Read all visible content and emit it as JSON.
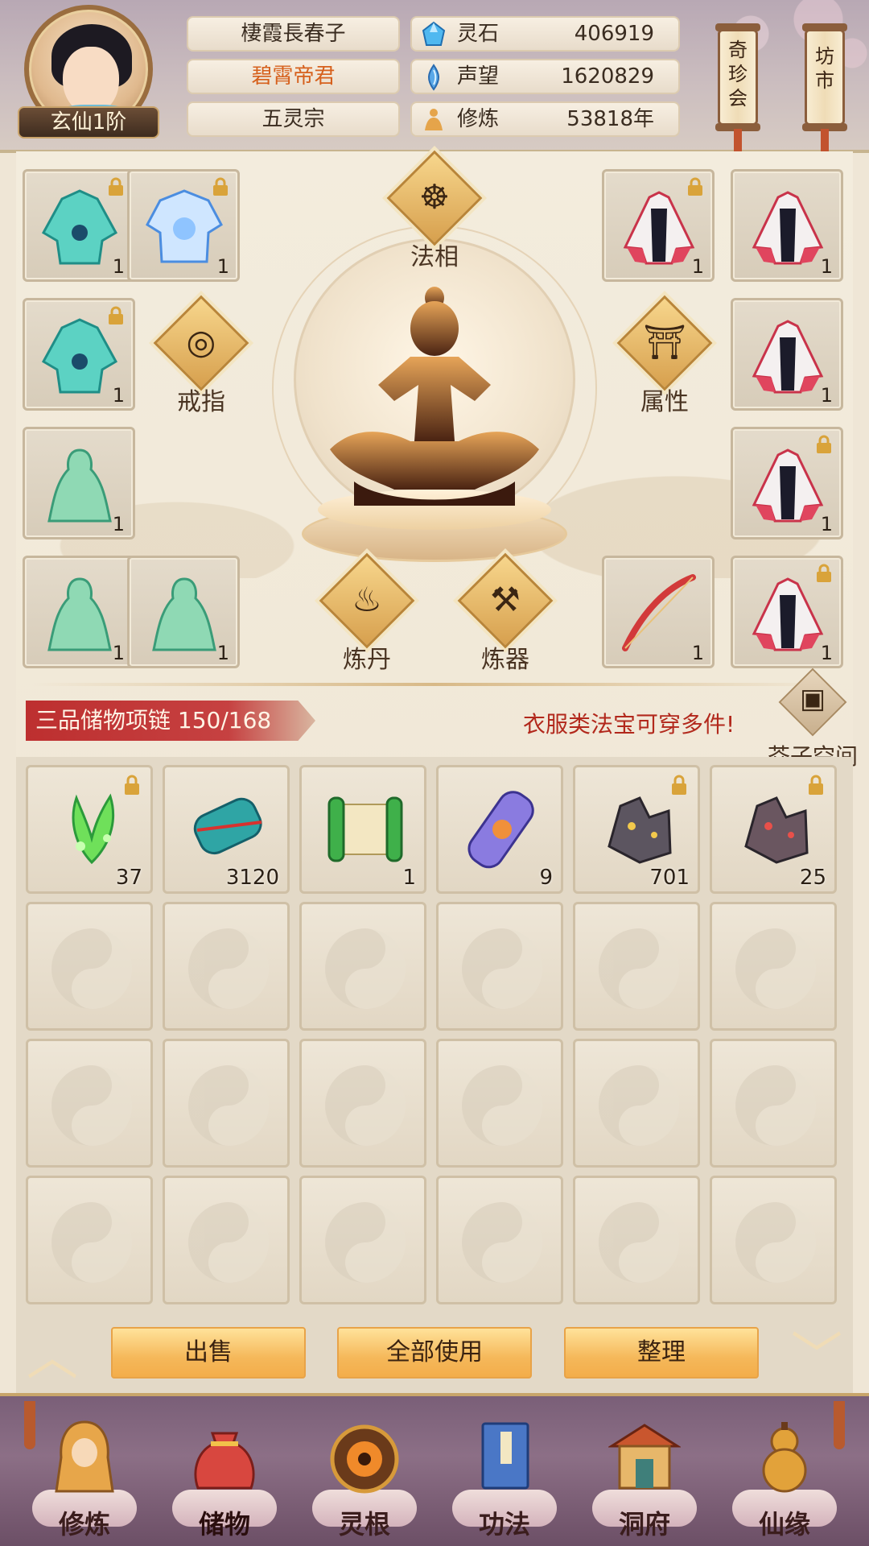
{
  "header": {
    "rank": "玄仙1阶",
    "name": "棲霞長春子",
    "title": "碧霄帝君",
    "sect": "五灵宗",
    "resources": [
      {
        "label": "灵石",
        "value": "406919",
        "icon": "spirit-stone-icon"
      },
      {
        "label": "声望",
        "value": "1620829",
        "icon": "prestige-icon"
      },
      {
        "label": "修炼",
        "value": "53818年",
        "icon": "meditation-icon"
      }
    ],
    "shop_buttons": [
      {
        "label": "奇珍会"
      },
      {
        "label": "坊市"
      }
    ]
  },
  "equip": {
    "center_buttons": {
      "faxiang": "法相",
      "ring": "戒指",
      "attr": "属性",
      "alchemy": "炼丹",
      "forge": "炼器"
    },
    "slots_left": [
      {
        "item": "robe-jade",
        "qty": "1",
        "locked": true
      },
      {
        "item": "armor-ice",
        "qty": "1",
        "locked": true
      },
      {
        "item": "robe-jade",
        "qty": "1",
        "locked": true
      },
      {
        "item": "spirit-green",
        "qty": "1",
        "locked": false
      },
      {
        "item": "spirit-green",
        "qty": "1",
        "locked": false
      },
      {
        "item": "spirit-green",
        "qty": "1",
        "locked": false
      }
    ],
    "slots_right": [
      {
        "item": "robe-crimson",
        "qty": "1",
        "locked": true
      },
      {
        "item": "robe-crimson",
        "qty": "1",
        "locked": false
      },
      {
        "item": "robe-crimson",
        "qty": "1",
        "locked": false
      },
      {
        "item": "robe-crimson",
        "qty": "1",
        "locked": true
      },
      {
        "item": "bow-red",
        "qty": "1",
        "locked": false
      },
      {
        "item": "robe-crimson",
        "qty": "1",
        "locked": true
      }
    ]
  },
  "storage": {
    "tag": "三品储物项链 150/168",
    "hint": "衣服类法宝可穿多件!",
    "space_label": "芥子空间"
  },
  "bag_items": [
    {
      "name": "green-herb",
      "qty": "37",
      "locked": true
    },
    {
      "name": "teal-scroll",
      "qty": "3120",
      "locked": false
    },
    {
      "name": "green-scroll",
      "qty": "1",
      "locked": false
    },
    {
      "name": "purple-scroll",
      "qty": "9",
      "locked": false
    },
    {
      "name": "dark-ore",
      "qty": "701",
      "locked": true
    },
    {
      "name": "red-ore",
      "qty": "25",
      "locked": true
    }
  ],
  "actions": {
    "sell": "出售",
    "use_all": "全部使用",
    "sort": "整理"
  },
  "nav": [
    {
      "label": "修炼",
      "icon": "hooded-monk-icon"
    },
    {
      "label": "储物",
      "icon": "treasure-bag-icon"
    },
    {
      "label": "灵根",
      "icon": "spirit-root-icon"
    },
    {
      "label": "功法",
      "icon": "book-icon"
    },
    {
      "label": "洞府",
      "icon": "pavilion-icon"
    },
    {
      "label": "仙缘",
      "icon": "gourd-icon"
    }
  ]
}
